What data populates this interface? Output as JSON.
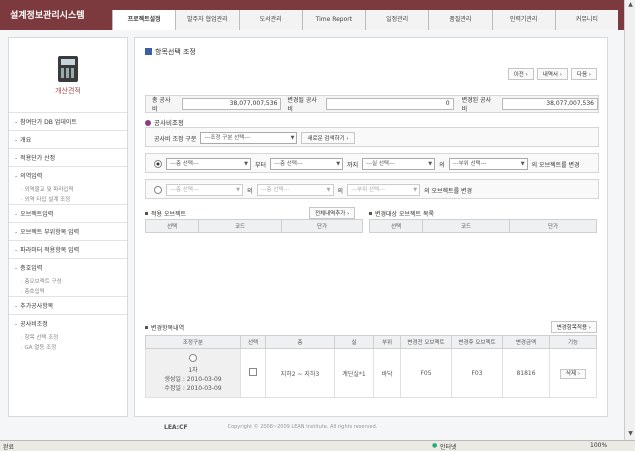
{
  "app": {
    "title": "설계정보관리시스템"
  },
  "nav_tabs": [
    {
      "label": "프로젝트설정",
      "active": true
    },
    {
      "label": "발주자 협업관리"
    },
    {
      "label": "도서관리"
    },
    {
      "label": "Time Report"
    },
    {
      "label": "일정관리"
    },
    {
      "label": "품질관리"
    },
    {
      "label": "인력기관리"
    },
    {
      "label": "커뮤니티"
    }
  ],
  "sidebar": {
    "header": "개산견적",
    "items": [
      {
        "label": "참여단가 DB 업데이트"
      },
      {
        "label": "개요"
      },
      {
        "label": "적용단가 산정"
      },
      {
        "label": "의역입력"
      },
      {
        "sub": "· 외역물교 및 파라입력"
      },
      {
        "sub": "· 외역 타입 설계 조정"
      },
      {
        "label": "오브젝트입력"
      },
      {
        "label": "오브젝트 부위항목 입력"
      },
      {
        "label": "파라미터 적용항목 입력"
      },
      {
        "label": "층호입력"
      },
      {
        "sub": "· 층오브젝트 구성"
      },
      {
        "sub": "· 층호입력"
      },
      {
        "label": "추가공사항목"
      },
      {
        "label": "공사비조정"
      },
      {
        "sub": "· 항목 선택 조정"
      },
      {
        "sub": "· GA 열등 조정"
      }
    ]
  },
  "main": {
    "title": "항목선택 조정",
    "nav_buttons": [
      "이전 ›",
      "내역서 ›",
      "다음 ›"
    ],
    "totals": {
      "total_label": "총 공사비",
      "total_value": "38,077,007,536",
      "changed_label": "변경될 공사비",
      "changed_value": "0",
      "after_label": "변경된 공사비",
      "after_value": "38,077,007,536"
    },
    "section_adjust": "공사비조정",
    "adjust_type_label": "공사비 조정 구분",
    "adjust_type_select": "---조정 구분 선택---",
    "adjust_type_btn": "새로운 검색하기 ›",
    "row1": {
      "sel1": "---층 선택---",
      "txt1": "부터",
      "sel2": "---층 선택---",
      "txt2": "까지",
      "sel3": "---실 선택---",
      "txt3": "의",
      "sel4": "---부위 선택---",
      "txt4": "의 오브젝트를 변경"
    },
    "row2": {
      "sel1": "---층 선택---",
      "txt1": "의",
      "sel2": "---층 선택---",
      "txt2": "의",
      "sel3": "---부위 선택---",
      "txt3": "의 오브젝트를 변경"
    },
    "left_list": {
      "title": "적용 오브젝트",
      "btn": "전체내역추가 ›",
      "headers": [
        "선택",
        "코드",
        "단가"
      ]
    },
    "right_list": {
      "title": "변경대상 오브젝트 목록",
      "headers": [
        "선택",
        "코드",
        "단가"
      ]
    },
    "change_list": {
      "title": "변경항목내역",
      "btn": "변경항목적용 ›",
      "headers": [
        "조정구분",
        "선택",
        "층",
        "실",
        "부위",
        "변경전 오브젝트",
        "변경후 오브젝트",
        "변경금액",
        "기능"
      ],
      "rows": [
        {
          "type_lines": [
            "1차",
            "생성일 : 2010-03-09",
            "수정일 : 2010-03-09"
          ],
          "floor": "지하2 ~ 지하3",
          "room": "계단실*1",
          "part": "바닥",
          "before": "F05",
          "after": "F03",
          "amount": "81816",
          "action": "삭제 ›"
        }
      ]
    }
  },
  "footer": {
    "logo": "LEA:CF",
    "copyright": "Copyright © 2008~2009 LEAN Institute. All rights reserved."
  },
  "status": {
    "left": "완료",
    "zone": "인터넷",
    "zoom": "100%"
  }
}
